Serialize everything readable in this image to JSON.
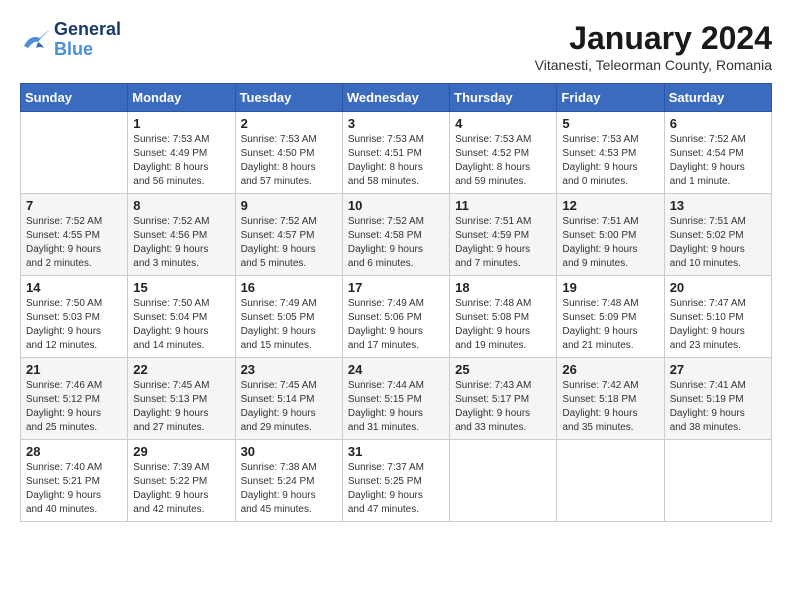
{
  "logo": {
    "name_part1": "General",
    "name_part2": "Blue"
  },
  "header": {
    "month_year": "January 2024",
    "location": "Vitanesti, Teleorman County, Romania"
  },
  "days_of_week": [
    "Sunday",
    "Monday",
    "Tuesday",
    "Wednesday",
    "Thursday",
    "Friday",
    "Saturday"
  ],
  "weeks": [
    [
      {
        "day": "",
        "info": ""
      },
      {
        "day": "1",
        "info": "Sunrise: 7:53 AM\nSunset: 4:49 PM\nDaylight: 8 hours\nand 56 minutes."
      },
      {
        "day": "2",
        "info": "Sunrise: 7:53 AM\nSunset: 4:50 PM\nDaylight: 8 hours\nand 57 minutes."
      },
      {
        "day": "3",
        "info": "Sunrise: 7:53 AM\nSunset: 4:51 PM\nDaylight: 8 hours\nand 58 minutes."
      },
      {
        "day": "4",
        "info": "Sunrise: 7:53 AM\nSunset: 4:52 PM\nDaylight: 8 hours\nand 59 minutes."
      },
      {
        "day": "5",
        "info": "Sunrise: 7:53 AM\nSunset: 4:53 PM\nDaylight: 9 hours\nand 0 minutes."
      },
      {
        "day": "6",
        "info": "Sunrise: 7:52 AM\nSunset: 4:54 PM\nDaylight: 9 hours\nand 1 minute."
      }
    ],
    [
      {
        "day": "7",
        "info": "Sunrise: 7:52 AM\nSunset: 4:55 PM\nDaylight: 9 hours\nand 2 minutes."
      },
      {
        "day": "8",
        "info": "Sunrise: 7:52 AM\nSunset: 4:56 PM\nDaylight: 9 hours\nand 3 minutes."
      },
      {
        "day": "9",
        "info": "Sunrise: 7:52 AM\nSunset: 4:57 PM\nDaylight: 9 hours\nand 5 minutes."
      },
      {
        "day": "10",
        "info": "Sunrise: 7:52 AM\nSunset: 4:58 PM\nDaylight: 9 hours\nand 6 minutes."
      },
      {
        "day": "11",
        "info": "Sunrise: 7:51 AM\nSunset: 4:59 PM\nDaylight: 9 hours\nand 7 minutes."
      },
      {
        "day": "12",
        "info": "Sunrise: 7:51 AM\nSunset: 5:00 PM\nDaylight: 9 hours\nand 9 minutes."
      },
      {
        "day": "13",
        "info": "Sunrise: 7:51 AM\nSunset: 5:02 PM\nDaylight: 9 hours\nand 10 minutes."
      }
    ],
    [
      {
        "day": "14",
        "info": "Sunrise: 7:50 AM\nSunset: 5:03 PM\nDaylight: 9 hours\nand 12 minutes."
      },
      {
        "day": "15",
        "info": "Sunrise: 7:50 AM\nSunset: 5:04 PM\nDaylight: 9 hours\nand 14 minutes."
      },
      {
        "day": "16",
        "info": "Sunrise: 7:49 AM\nSunset: 5:05 PM\nDaylight: 9 hours\nand 15 minutes."
      },
      {
        "day": "17",
        "info": "Sunrise: 7:49 AM\nSunset: 5:06 PM\nDaylight: 9 hours\nand 17 minutes."
      },
      {
        "day": "18",
        "info": "Sunrise: 7:48 AM\nSunset: 5:08 PM\nDaylight: 9 hours\nand 19 minutes."
      },
      {
        "day": "19",
        "info": "Sunrise: 7:48 AM\nSunset: 5:09 PM\nDaylight: 9 hours\nand 21 minutes."
      },
      {
        "day": "20",
        "info": "Sunrise: 7:47 AM\nSunset: 5:10 PM\nDaylight: 9 hours\nand 23 minutes."
      }
    ],
    [
      {
        "day": "21",
        "info": "Sunrise: 7:46 AM\nSunset: 5:12 PM\nDaylight: 9 hours\nand 25 minutes."
      },
      {
        "day": "22",
        "info": "Sunrise: 7:45 AM\nSunset: 5:13 PM\nDaylight: 9 hours\nand 27 minutes."
      },
      {
        "day": "23",
        "info": "Sunrise: 7:45 AM\nSunset: 5:14 PM\nDaylight: 9 hours\nand 29 minutes."
      },
      {
        "day": "24",
        "info": "Sunrise: 7:44 AM\nSunset: 5:15 PM\nDaylight: 9 hours\nand 31 minutes."
      },
      {
        "day": "25",
        "info": "Sunrise: 7:43 AM\nSunset: 5:17 PM\nDaylight: 9 hours\nand 33 minutes."
      },
      {
        "day": "26",
        "info": "Sunrise: 7:42 AM\nSunset: 5:18 PM\nDaylight: 9 hours\nand 35 minutes."
      },
      {
        "day": "27",
        "info": "Sunrise: 7:41 AM\nSunset: 5:19 PM\nDaylight: 9 hours\nand 38 minutes."
      }
    ],
    [
      {
        "day": "28",
        "info": "Sunrise: 7:40 AM\nSunset: 5:21 PM\nDaylight: 9 hours\nand 40 minutes."
      },
      {
        "day": "29",
        "info": "Sunrise: 7:39 AM\nSunset: 5:22 PM\nDaylight: 9 hours\nand 42 minutes."
      },
      {
        "day": "30",
        "info": "Sunrise: 7:38 AM\nSunset: 5:24 PM\nDaylight: 9 hours\nand 45 minutes."
      },
      {
        "day": "31",
        "info": "Sunrise: 7:37 AM\nSunset: 5:25 PM\nDaylight: 9 hours\nand 47 minutes."
      },
      {
        "day": "",
        "info": ""
      },
      {
        "day": "",
        "info": ""
      },
      {
        "day": "",
        "info": ""
      }
    ]
  ]
}
